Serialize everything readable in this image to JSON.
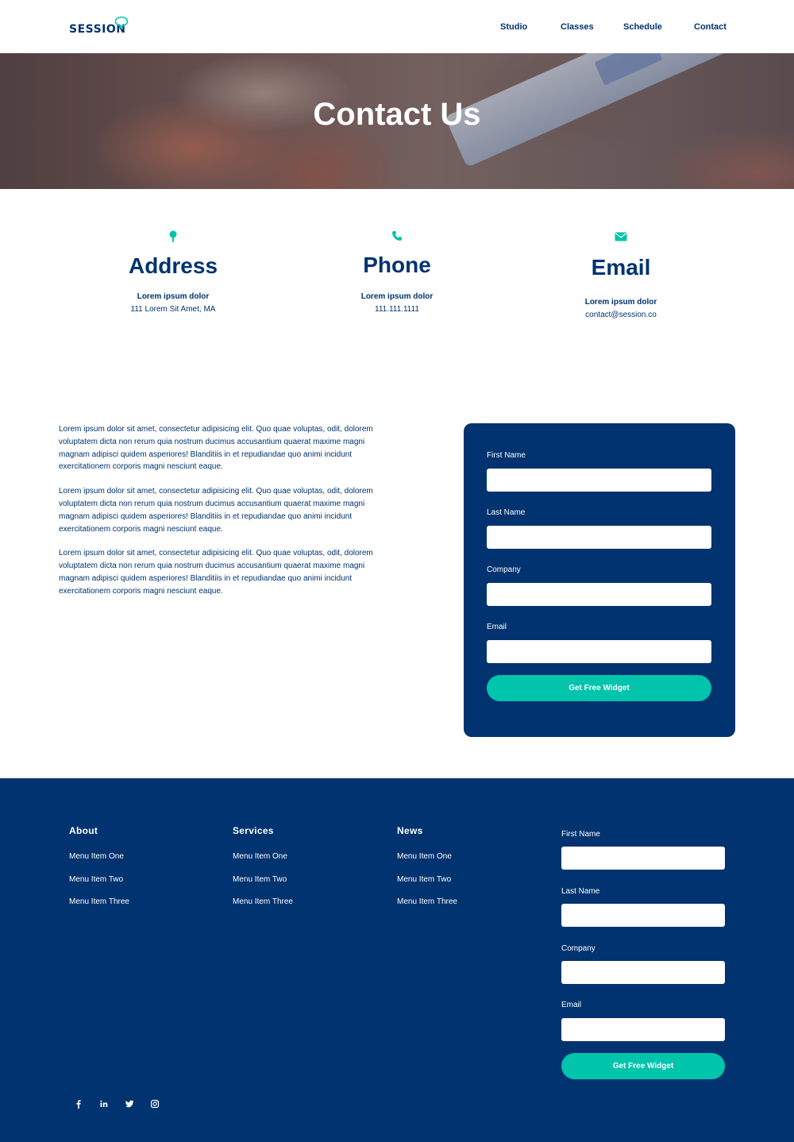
{
  "header": {
    "logo_text": "SESSION",
    "nav": [
      "Studio",
      "Classes",
      "Schedule",
      "Contact"
    ]
  },
  "hero": {
    "title": "Contact Us"
  },
  "info": [
    {
      "icon": "map-pin-icon",
      "heading": "Address",
      "label": "Lorem ipsum dolor",
      "value": "111 Lorem Sit Amet, MA"
    },
    {
      "icon": "phone-icon",
      "heading": "Phone",
      "label": "Lorem ipsum dolor",
      "value": "111.111.1111"
    },
    {
      "icon": "envelope-icon",
      "heading": "Email",
      "label": "Lorem ipsum dolor",
      "value": "contact@session.co"
    }
  ],
  "paragraphs": [
    "Lorem ipsum dolor sit amet, consectetur adipisicing elit. Quo quae voluptas, odit, dolorem voluptatem dicta non rerum quia nostrum ducimus accusantium quaerat maxime magni magnam adipisci quidem asperiores! Blanditiis in et repudiandae quo animi incidunt exercitationem corporis magni nesciunt eaque.",
    "Lorem ipsum dolor sit amet, consectetur adipisicing elit. Quo quae voluptas, odit, dolorem voluptatem dicta non rerum quia nostrum ducimus accusantium quaerat maxime magni magnam adipisci quidem asperiores! Blanditiis in et repudiandae quo animi incidunt exercitationem corporis magni nesciunt eaque.",
    "Lorem ipsum dolor sit amet, consectetur adipisicing elit. Quo quae voluptas, odit, dolorem voluptatem dicta non rerum quia nostrum ducimus accusantium quaerat maxime magni magnam adipisci quidem asperiores! Blanditiis in et repudiandae quo animi incidunt exercitationem corporis magni nesciunt eaque."
  ],
  "contact_form": {
    "fields": [
      {
        "label": "First Name",
        "value": ""
      },
      {
        "label": "Last Name",
        "value": ""
      },
      {
        "label": "Company",
        "value": ""
      },
      {
        "label": "Email",
        "value": ""
      }
    ],
    "submit_label": "Get Free Widget"
  },
  "footer": {
    "columns": [
      {
        "heading": "About",
        "items": [
          "Menu Item One",
          "Menu Item Two",
          "Menu Item Three"
        ]
      },
      {
        "heading": "Services",
        "items": [
          "Menu Item One",
          "Menu Item Two",
          "Menu Item Three"
        ]
      },
      {
        "heading": "News",
        "items": [
          "Menu Item One",
          "Menu Item Two",
          "Menu Item Three"
        ]
      }
    ],
    "form": {
      "fields": [
        {
          "label": "First Name",
          "value": ""
        },
        {
          "label": "Last Name",
          "value": ""
        },
        {
          "label": "Company",
          "value": ""
        },
        {
          "label": "Email",
          "value": ""
        }
      ],
      "submit_label": "Get Free Widget"
    },
    "social_icons": [
      "facebook-icon",
      "linkedin-icon",
      "twitter-icon",
      "instagram-icon"
    ]
  },
  "colors": {
    "navy": "#003370",
    "teal": "#00c4ab",
    "white": "#ffffff"
  }
}
